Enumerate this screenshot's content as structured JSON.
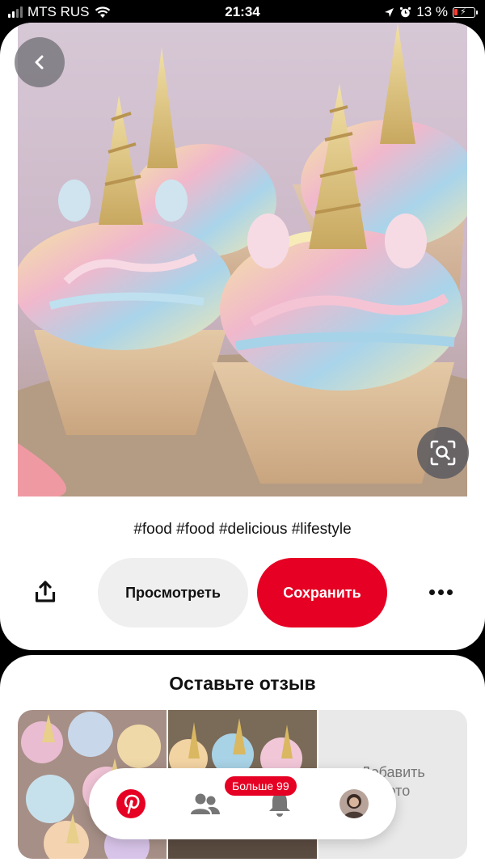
{
  "status_bar": {
    "carrier": "MTS RUS",
    "time": "21:34",
    "battery": "13 %"
  },
  "pin": {
    "hashtags": "#food #food #delicious #lifestyle",
    "visit_label": "Просмотреть",
    "save_label": "Сохранить"
  },
  "comments": {
    "title": "Оставьте отзыв",
    "add_photo_label": "Добавить\nфото"
  },
  "nav": {
    "notification_badge": "Больше 99"
  },
  "colors": {
    "brand_red": "#e60023",
    "button_gray": "#efefef"
  },
  "icons": [
    "back-icon",
    "visual-search-icon",
    "share-icon",
    "more-icon",
    "pinterest-home-icon",
    "following-icon",
    "bell-icon",
    "avatar"
  ]
}
